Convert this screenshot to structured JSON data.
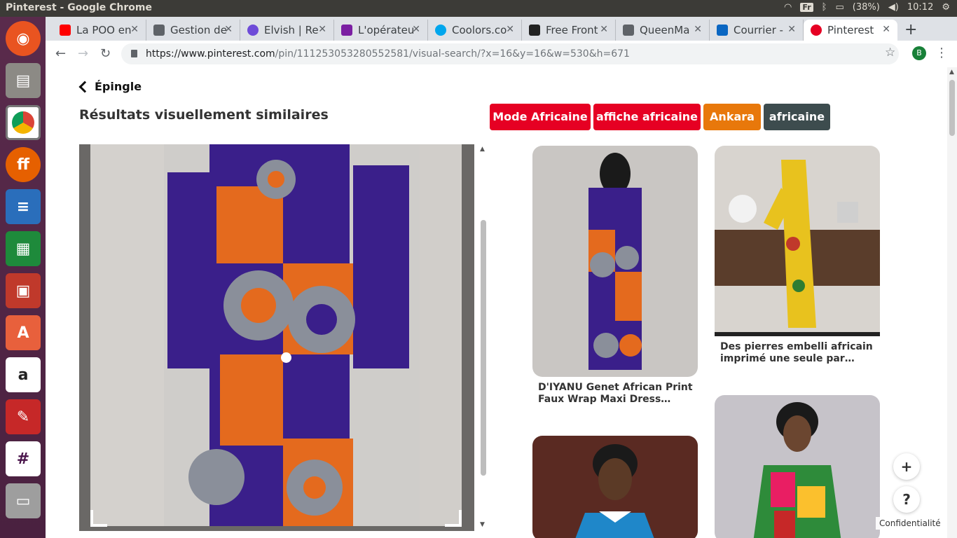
{
  "window": {
    "title": "Pinterest - Google Chrome"
  },
  "status": {
    "keyboard": "Fr",
    "battery": "(38%)",
    "time": "10:12"
  },
  "tabs": [
    {
      "label": "La POO en",
      "color": "#ff0000"
    },
    {
      "label": "Gestion de",
      "color": "#5f6368"
    },
    {
      "label": "Elvish | Re",
      "color": "#6e4bd8"
    },
    {
      "label": "L'opérateu",
      "color": "#7b1fa2"
    },
    {
      "label": "Coolors.co",
      "color": "#00a6ed"
    },
    {
      "label": "Free Front",
      "color": "#222222"
    },
    {
      "label": "QueenMa",
      "color": "#5f6368"
    },
    {
      "label": "Courrier - ",
      "color": "#0a66c2"
    },
    {
      "label": "Pinterest",
      "color": "#e60023"
    }
  ],
  "toolbar": {
    "url_domain": "https://www.pinterest.com",
    "url_path": "/pin/111253053280552581/visual-search/?x=16&y=16&w=530&h=671",
    "profile_initial": "B"
  },
  "page": {
    "back_label": "Épingle",
    "heading": "Résultats visuellement similaires",
    "chips": [
      {
        "label": "Mode Africaine",
        "color": "#e60023"
      },
      {
        "label": "affiche africaine",
        "color": "#e60023"
      },
      {
        "label": "Ankara",
        "color": "#e8780b"
      },
      {
        "label": "africaine",
        "color": "#3d4c4e"
      }
    ],
    "pins": [
      {
        "caption": "D'IYANU Genet African Print Faux Wrap Maxi Dress…"
      },
      {
        "caption": "Des pierres embelli africain imprimé une seule par…"
      },
      {
        "caption": ""
      },
      {
        "caption": ""
      }
    ],
    "plus": "+",
    "help": "?",
    "privacy": "Confidentialité"
  }
}
